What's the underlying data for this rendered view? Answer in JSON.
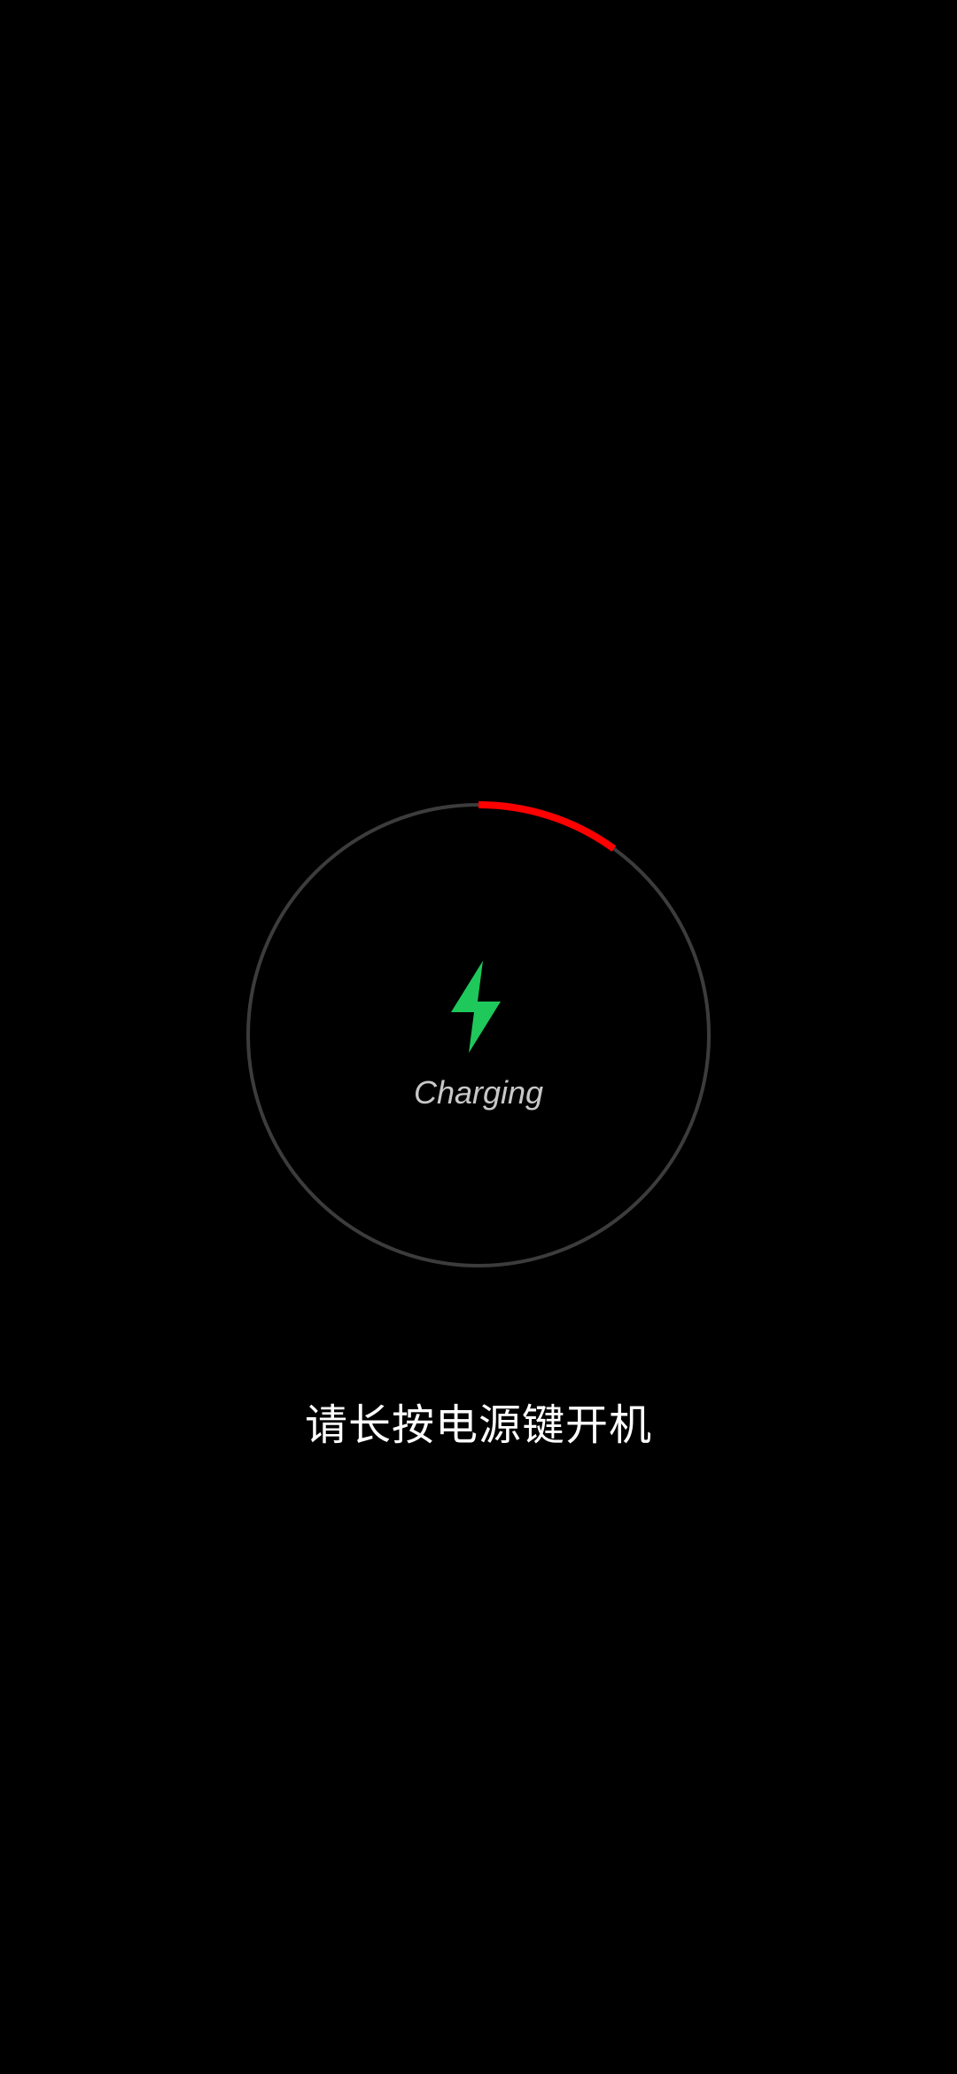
{
  "charging": {
    "status_label": "Charging",
    "battery_level_fraction": 0.1,
    "colors": {
      "track": "#3c3c3c",
      "progress": "#ff0000",
      "bolt": "#1ec85a",
      "status_text": "#c8c8c8"
    },
    "icon": "lightning-bolt-icon"
  },
  "hint": {
    "text": "请长按电源键开机"
  },
  "background_color": "#000000"
}
